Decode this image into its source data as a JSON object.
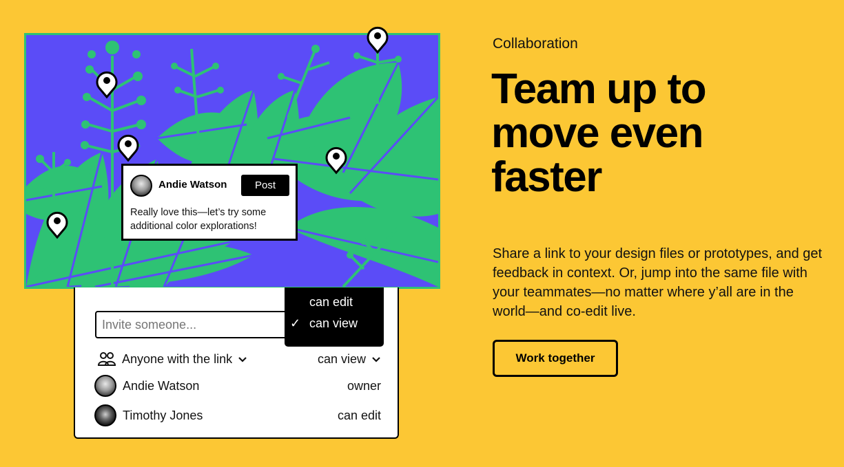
{
  "colors": {
    "background": "#FCC734",
    "illustration_bg": "#5B4CF7",
    "illustration_leaf": "#2EC274",
    "ink": "#000000",
    "card": "#FFFFFF"
  },
  "hero": {
    "eyebrow": "Collaboration",
    "headline": "Team up to move even faster",
    "body": "Share a link to your design files or prototypes, and get feedback in context. Or, jump into the same file with your teammates—no matter where y’all are in the world—and co-edit live.",
    "cta_label": "Work together"
  },
  "comment": {
    "author": "Andie Watson",
    "post_label": "Post",
    "text": "Really love this—let’s try some additional color explorations!"
  },
  "share": {
    "invite_placeholder": "Invite someone...",
    "permission_menu": {
      "options": [
        {
          "label": "can edit",
          "selected": false
        },
        {
          "label": "can view",
          "selected": true
        }
      ],
      "check_icon": "✓"
    },
    "link_access": {
      "icon": "people-icon",
      "label": "Anyone with the link",
      "permission": "can view"
    },
    "members": [
      {
        "name": "Andie Watson",
        "role": "owner"
      },
      {
        "name": "Timothy Jones",
        "role": "can edit"
      }
    ]
  },
  "pins": [
    {
      "icon": "map-pin-icon"
    },
    {
      "icon": "map-pin-icon"
    },
    {
      "icon": "map-pin-icon"
    },
    {
      "icon": "map-pin-icon"
    },
    {
      "icon": "map-pin-icon"
    }
  ]
}
